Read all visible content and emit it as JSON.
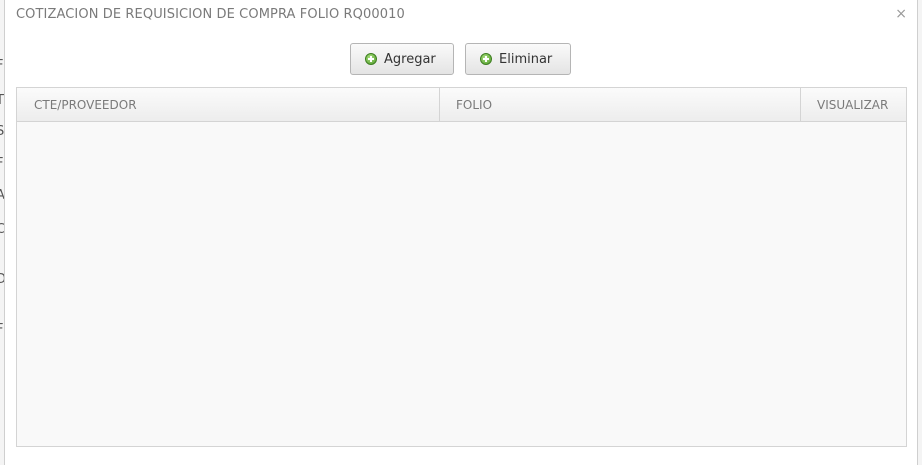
{
  "dialog": {
    "title": "COTIZACION DE REQUISICION DE COMPRA FOLIO RQ00010",
    "close_glyph": "×"
  },
  "toolbar": {
    "add_label": "Agregar",
    "delete_label": "Eliminar"
  },
  "grid": {
    "columns": [
      "CTE/PROVEEDOR",
      "FOLIO",
      "VISUALIZAR"
    ],
    "rows": []
  },
  "background": {
    "letters": [
      "F",
      "T",
      "S",
      "F",
      "A",
      "C",
      "D",
      "F"
    ]
  },
  "colors": {
    "icon_green": "#4f9a2b",
    "header_text": "#7a7a7a"
  }
}
